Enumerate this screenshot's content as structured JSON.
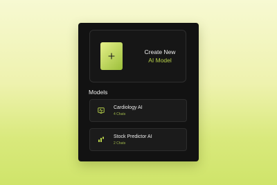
{
  "create": {
    "title": "Create New",
    "subtitle": "AI Model",
    "icon": "plus-icon"
  },
  "models": {
    "section_title": "Models",
    "items": [
      {
        "name": "Cardiology AI",
        "meta": "4 Chats",
        "icon": "monitor-icon"
      },
      {
        "name": "Stock Predictor AI",
        "meta": "2 Chats",
        "icon": "bar-chart-icon"
      }
    ]
  },
  "colors": {
    "accent": "#b8d24a",
    "panel": "#121212",
    "card": "#1b1b1b"
  }
}
